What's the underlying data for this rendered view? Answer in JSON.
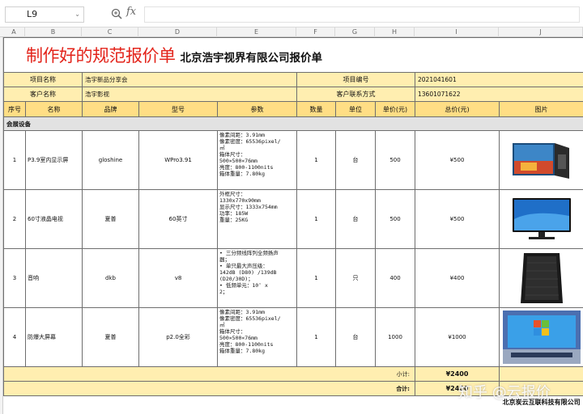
{
  "formula_bar": {
    "cell_ref": "L9",
    "fx_label": "fx",
    "formula_value": ""
  },
  "columns": [
    "A",
    "B",
    "C",
    "D",
    "E",
    "F",
    "G",
    "H",
    "I",
    "J"
  ],
  "title": {
    "main": "制作好的规范报价单",
    "company": "北京浩宇视界有限公司报价单"
  },
  "info": {
    "project_name_label": "项目名称",
    "project_name_value": "浩宇新品分享会",
    "project_no_label": "项目编号",
    "project_no_value": "2021041601",
    "client_label": "客户名称",
    "client_value": "浩宇影视",
    "contact_label": "客户联系方式",
    "contact_value": "13601071622"
  },
  "headers": [
    "序号",
    "名称",
    "品牌",
    "型号",
    "参数",
    "数量",
    "单位",
    "单价(元)",
    "总价(元)",
    "图片"
  ],
  "section": "会展设备",
  "rows": [
    {
      "no": "1",
      "name": "P3.9室内显示屏",
      "brand": "gloshine",
      "model": "WPro3.91",
      "params": [
        "像素间距：3.91mm",
        "像素密度：65536pixel/",
        "㎡",
        "箱体尺寸：",
        "500×500×76mm",
        "亮度：800-1100nits",
        "箱体重量：7.80kg"
      ],
      "qty": "1",
      "unit": "台",
      "price": "500",
      "total": "¥500",
      "image": "led-display-cabinet"
    },
    {
      "no": "2",
      "name": "60寸液晶电视",
      "brand": "夏普",
      "model": "60英寸",
      "params": [
        "外框尺寸：",
        "1330x770x90mm",
        "显示尺寸：1333x754mm",
        "功率：185W",
        "重量：25KG"
      ],
      "qty": "1",
      "unit": "台",
      "price": "500",
      "total": "¥500",
      "image": "lcd-tv"
    },
    {
      "no": "3",
      "name": "音响",
      "brand": "dkb",
      "model": "v8",
      "params": [
        "• 三分频线阵列全频扬声",
        "器；",
        "• 单只最大声压级：",
        "142dB (D80) /139dB",
        "(D20/30D)；",
        "• 低频单元：10″ x",
        "2；"
      ],
      "qty": "1",
      "unit": "只",
      "price": "400",
      "total": "¥400",
      "image": "speaker"
    },
    {
      "no": "4",
      "name": "防爆大屏幕",
      "brand": "夏普",
      "model": "p2.0全彩",
      "params": [
        "像素间距：3.91mm",
        "像素密度：65536pixel/",
        "㎡",
        "箱体尺寸：",
        "500×500×76mm",
        "亮度：800-1100nits",
        "箱体重量：7.80kg"
      ],
      "qty": "1",
      "unit": "台",
      "price": "1000",
      "total": "¥1000",
      "image": "video-wall"
    }
  ],
  "subtotal_label": "小计:",
  "subtotal_value": "¥2400",
  "grand_total_label": "合计:",
  "grand_total_value": "¥2400",
  "footer_company": "北京炭云互联科技有限公司",
  "watermark": "知乎 @云报价"
}
